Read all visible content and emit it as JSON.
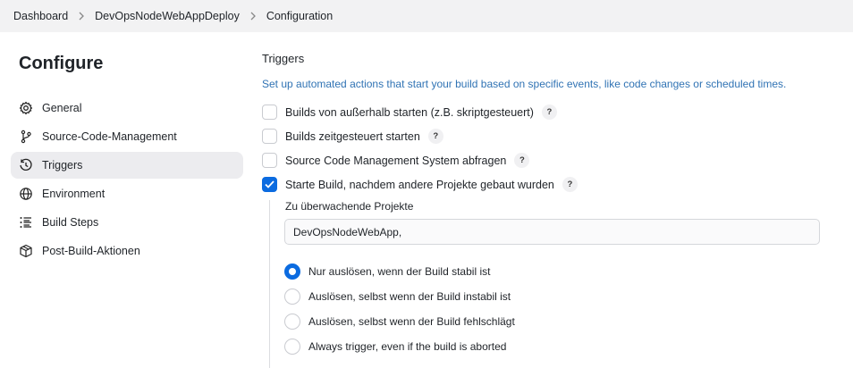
{
  "breadcrumb": {
    "items": [
      "Dashboard",
      "DevOpsNodeWebAppDeploy",
      "Configuration"
    ]
  },
  "sidebar": {
    "title": "Configure",
    "items": [
      {
        "label": "General",
        "icon": "gear-icon"
      },
      {
        "label": "Source-Code-Management",
        "icon": "branch-icon"
      },
      {
        "label": "Triggers",
        "icon": "clock-icon",
        "active": true
      },
      {
        "label": "Environment",
        "icon": "globe-icon"
      },
      {
        "label": "Build Steps",
        "icon": "list-icon"
      },
      {
        "label": "Post-Build-Aktionen",
        "icon": "package-icon"
      }
    ]
  },
  "triggers": {
    "title": "Triggers",
    "description": "Set up automated actions that start your build based on specific events, like code changes or scheduled times.",
    "help_symbol": "?",
    "options": [
      {
        "label": "Builds von außerhalb starten (z.B. skriptgesteuert)",
        "checked": false
      },
      {
        "label": "Builds zeitgesteuert starten",
        "checked": false
      },
      {
        "label": "Source Code Management System abfragen",
        "checked": false
      },
      {
        "label": "Starte Build, nachdem andere Projekte gebaut wurden",
        "checked": true
      }
    ],
    "projects_label": "Zu überwachende Projekte",
    "projects_value": "DevOpsNodeWebApp,",
    "radio_options": [
      {
        "label": "Nur auslösen, wenn der Build stabil ist",
        "selected": true
      },
      {
        "label": "Auslösen, selbst wenn der Build instabil ist",
        "selected": false
      },
      {
        "label": "Auslösen, selbst wenn der Build fehlschlägt",
        "selected": false
      },
      {
        "label": "Always trigger, even if the build is aborted",
        "selected": false
      }
    ]
  },
  "colors": {
    "accent": "#0b6be0",
    "link": "#3073b4",
    "breadcrumb_bg": "#f2f2f3",
    "active_bg": "#ececef"
  }
}
